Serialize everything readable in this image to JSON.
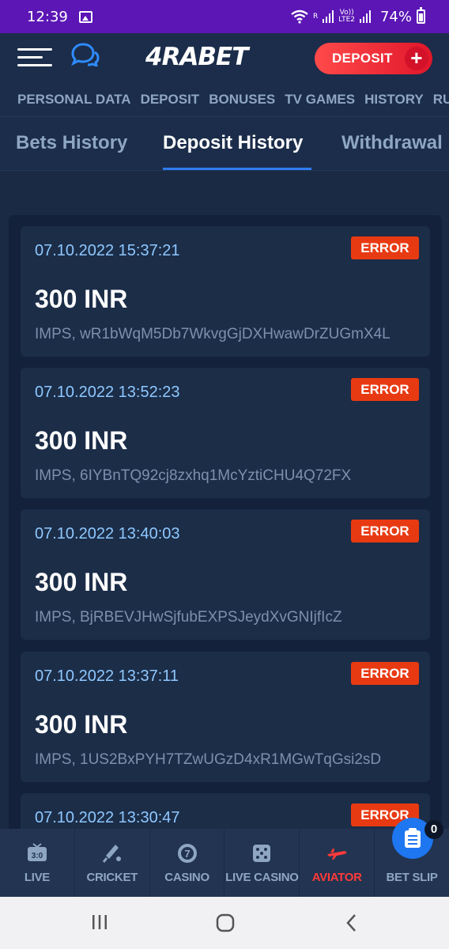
{
  "status_bar": {
    "time": "12:39",
    "network_r": "R",
    "network_volte": "Vo))",
    "network_lte": "LTE2",
    "battery": "74%",
    "colors": {
      "background": "#5b16b5"
    }
  },
  "header": {
    "logo": "4RABET",
    "deposit_button": "DEPOSIT",
    "deposit_plus": "+",
    "icons": {
      "menu": "hamburger-menu-icon",
      "chat": "chat-bubbles-icon"
    }
  },
  "section_nav": {
    "items": [
      "PERSONAL DATA",
      "DEPOSIT",
      "BONUSES",
      "TV GAMES",
      "HISTORY",
      "RUL"
    ]
  },
  "tabs": {
    "items": [
      "Bets History",
      "Deposit History",
      "Withdrawal"
    ],
    "active": "Deposit History"
  },
  "deposits": [
    {
      "date": "07.10.2022 15:37:21",
      "status": "ERROR",
      "amount": "300 INR",
      "ref": "IMPS, wR1bWqM5Db7WkvgGjDXHwawDrZUGmX4L"
    },
    {
      "date": "07.10.2022 13:52:23",
      "status": "ERROR",
      "amount": "300 INR",
      "ref": "IMPS, 6IYBnTQ92cj8zxhq1McYztiCHU4Q72FX"
    },
    {
      "date": "07.10.2022 13:40:03",
      "status": "ERROR",
      "amount": "300 INR",
      "ref": "IMPS, BjRBEVJHwSjfubEXPSJeydXvGNIjfIcZ"
    },
    {
      "date": "07.10.2022 13:37:11",
      "status": "ERROR",
      "amount": "300 INR",
      "ref": "IMPS, 1US2BxPYH7TZwUGzD4xR1MGwTqGsi2sD"
    },
    {
      "date": "07.10.2022 13:30:47",
      "status": "ERROR",
      "amount": "",
      "ref": ""
    }
  ],
  "bottom_nav": {
    "items": [
      {
        "label": "LIVE",
        "icon": "live-tv-icon"
      },
      {
        "label": "CRICKET",
        "icon": "cricket-bat-icon"
      },
      {
        "label": "CASINO",
        "icon": "casino-chip-icon"
      },
      {
        "label": "LIVE CASINO",
        "icon": "dice-icon"
      },
      {
        "label": "AVIATOR",
        "icon": "plane-icon"
      },
      {
        "label": "BET SLIP",
        "icon": ""
      }
    ],
    "bet_slip_count": "0",
    "colors": {
      "aviator": "#ff3a3a",
      "fab": "#1e76f0"
    }
  },
  "theme": {
    "background": "#1a2a44",
    "card": "#1c2d48",
    "error_badge": "#e83a12",
    "date_text": "#8ec8ff",
    "accent_underline": "#2f7cf0"
  }
}
